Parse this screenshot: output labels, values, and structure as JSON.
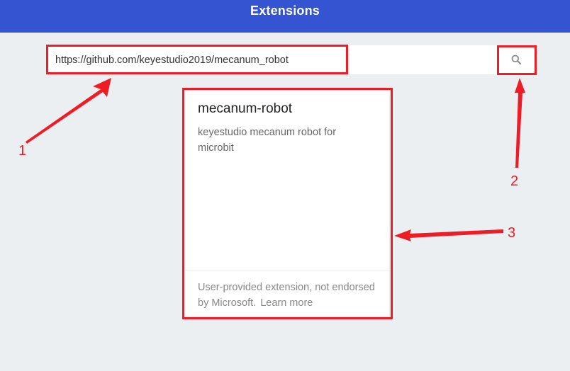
{
  "header": {
    "title": "Extensions"
  },
  "search": {
    "value": "https://github.com/keyestudio2019/mecanum_robot",
    "button_icon": "search-icon"
  },
  "card": {
    "title": "mecanum-robot",
    "description": "keyestudio mecanum robot for microbit",
    "footer_text": "User-provided extension, not endorsed by Microsoft.",
    "learn_more": "Learn more"
  },
  "annotations": {
    "label_1": "1",
    "label_2": "2",
    "label_3": "3",
    "color": "#ee1c25"
  },
  "colors": {
    "header_bg": "#3454d1",
    "page_bg": "#eceff1"
  }
}
